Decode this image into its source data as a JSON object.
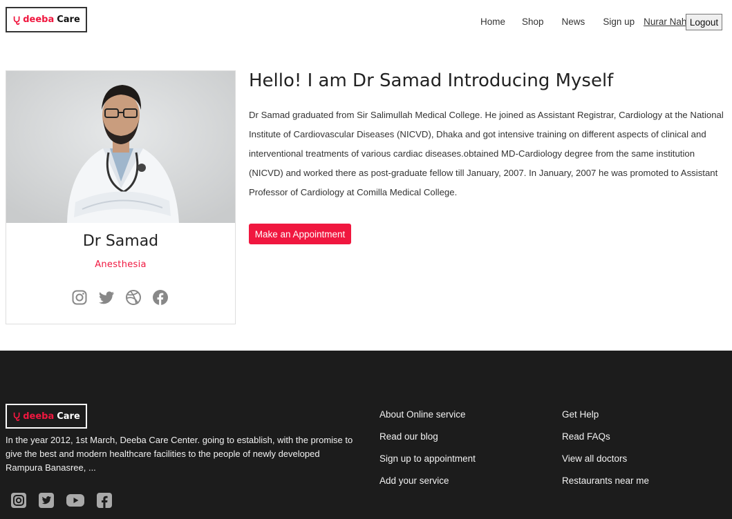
{
  "brand": {
    "name_a": "deeba",
    "name_b": "Care",
    "accent_color": "#f0173f",
    "logo_icon": "stethoscope-icon"
  },
  "nav": {
    "items": [
      "Home",
      "Shop",
      "News",
      "Sign up"
    ],
    "user": "Nurar Nahar",
    "logout": "Logout"
  },
  "doctor": {
    "name": "Dr Samad",
    "specialty": "Anesthesia",
    "social_icons": [
      "instagram-icon",
      "twitter-icon",
      "dribbble-icon",
      "facebook-icon"
    ]
  },
  "intro": {
    "title": "Hello! I am Dr Samad Introducing Myself",
    "body": "Dr Samad graduated from Sir Salimullah Medical College. He joined as Assistant Registrar, Cardiology at the National Institute of Cardiovascular Diseases (NICVD), Dhaka and got intensive training on different aspects of clinical and interventional treatments of various cardiac diseases.obtained MD-Cardiology degree from the same institution (NICVD) and worked there as post-graduate fellow till January, 2007. In January, 2007 he was promoted to Assistant Professor of Cardiology at Comilla Medical College.",
    "button": "Make an Appointment"
  },
  "footer": {
    "about": "In the year 2012, 1st March, Deeba Care Center. going to establish, with the promise to give the best and modern healthcare facilities to the people of newly developed Rampura Banasree, ...",
    "col1": [
      "About Online service",
      "Read our blog",
      "Sign up to appointment",
      "Add your service"
    ],
    "col2": [
      "Get Help",
      "Read FAQs",
      "View all doctors",
      "Restaurants near me"
    ],
    "social_icons": [
      "instagram-icon",
      "twitter-icon",
      "youtube-icon",
      "facebook-icon"
    ],
    "background": "#1c1c1c"
  }
}
